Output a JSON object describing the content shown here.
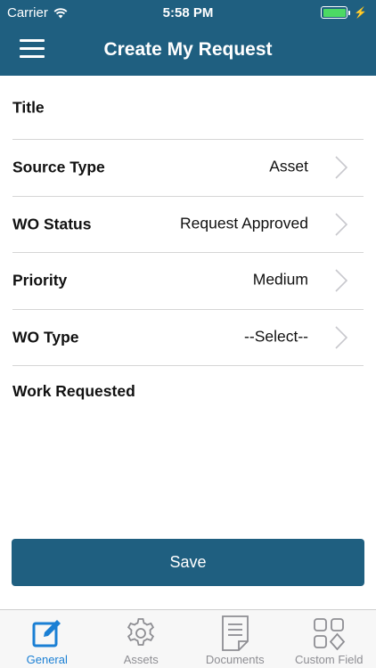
{
  "status_bar": {
    "carrier": "Carrier",
    "time": "5:58 PM"
  },
  "header": {
    "title": "Create My Request"
  },
  "form": {
    "rows": [
      {
        "label": "Title",
        "value": ""
      },
      {
        "label": "Source Type",
        "value": "Asset"
      },
      {
        "label": "WO Status",
        "value": "Request Approved"
      },
      {
        "label": "Priority",
        "value": "Medium"
      },
      {
        "label": "WO Type",
        "value": "--Select--"
      }
    ],
    "work_requested_label": "Work Requested"
  },
  "save_label": "Save",
  "tabs": [
    {
      "label": "General",
      "icon": "pencil-square-icon",
      "active": true
    },
    {
      "label": "Assets",
      "icon": "gear-icon",
      "active": false
    },
    {
      "label": "Documents",
      "icon": "document-icon",
      "active": false
    },
    {
      "label": "Custom Field",
      "icon": "shapes-grid-icon",
      "active": false
    }
  ],
  "colors": {
    "primary": "#1f5f80",
    "tab_active": "#1a7fd4",
    "tab_inactive": "#8e8e93",
    "battery": "#4cd964"
  }
}
